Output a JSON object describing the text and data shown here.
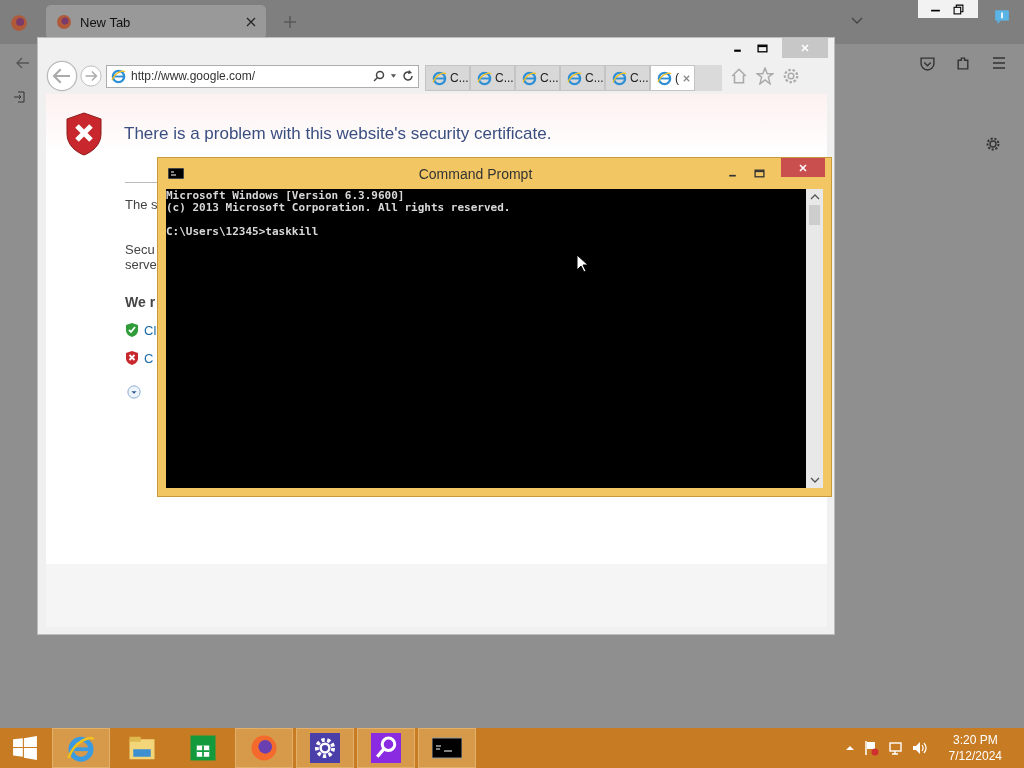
{
  "firefox": {
    "tab": {
      "title": "New Tab",
      "selected": true
    }
  },
  "ie": {
    "address": "http://www.google.com/",
    "tabs": [
      {
        "label": "C...",
        "selected": false
      },
      {
        "label": "C...",
        "selected": false
      },
      {
        "label": "C...",
        "selected": false
      },
      {
        "label": "C...",
        "selected": false
      },
      {
        "label": "C...",
        "selected": false
      },
      {
        "label": "(",
        "selected": true
      }
    ],
    "heading": "There is a problem with this website's security certificate.",
    "texts": [
      {
        "kind": "text",
        "text": "The s"
      },
      {
        "kind": "text",
        "text": "Secu"
      },
      {
        "kind": "text",
        "text": "serve"
      },
      {
        "kind": "bold",
        "text": "We r"
      },
      {
        "kind": "good",
        "text": "Cl"
      },
      {
        "kind": "bad",
        "text": "C"
      },
      {
        "kind": "more"
      }
    ]
  },
  "cmd": {
    "title": "Command Prompt",
    "lines": [
      {
        "kind": "output",
        "text": "Microsoft Windows [Version 6.3.9600]"
      },
      {
        "kind": "output",
        "text": "(c) 2013 Microsoft Corporation. All rights reserved."
      },
      {
        "kind": "blank"
      },
      {
        "kind": "prompt",
        "text": "C:\\Users\\12345>taskkill"
      }
    ]
  },
  "taskbar": {
    "apps": [
      {
        "kind": "ie",
        "selected": true
      },
      {
        "kind": "explorer",
        "selected": false
      },
      {
        "kind": "store",
        "selected": false
      },
      {
        "kind": "firefox",
        "selected": true
      },
      {
        "kind": "settings",
        "selected": true
      },
      {
        "kind": "search",
        "selected": true
      },
      {
        "kind": "cmd",
        "selected": true
      }
    ],
    "time": "3:20 PM",
    "date": "7/12/2024"
  }
}
